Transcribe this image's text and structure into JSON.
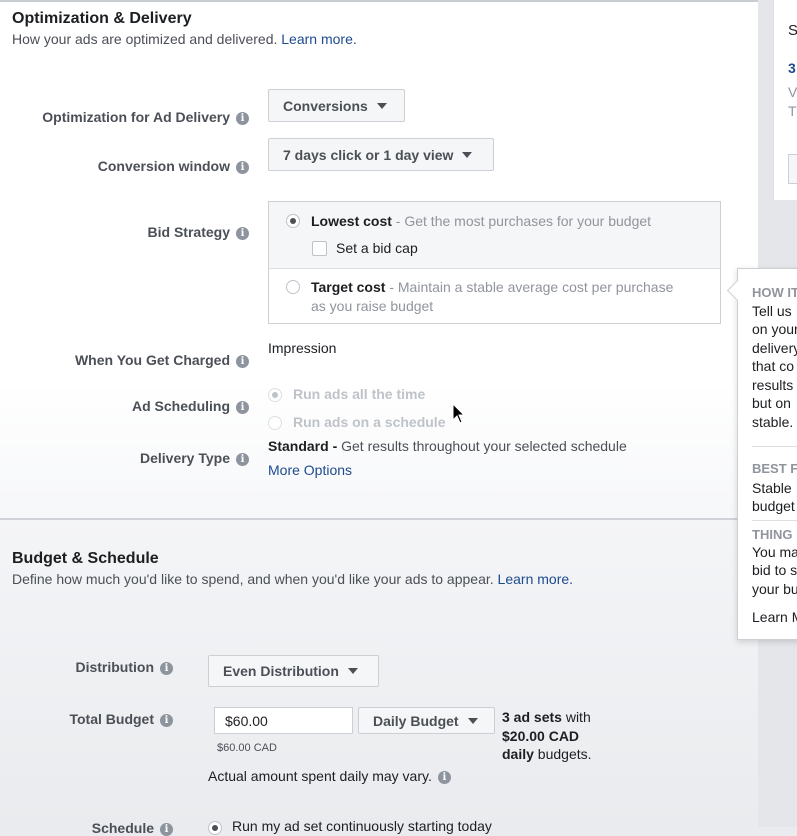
{
  "optimization": {
    "title": "Optimization & Delivery",
    "subtitle": "How your ads are optimized and delivered.",
    "learn_more": "Learn more.",
    "opt_label": "Optimization for Ad Delivery",
    "opt_value": "Conversions",
    "window_label": "Conversion window",
    "window_value": "7 days click or 1 day view",
    "bid_label": "Bid Strategy",
    "bid_lowest_title": "Lowest cost",
    "bid_lowest_desc": " - Get the most purchases for your budget",
    "bid_cap_label": "Set a bid cap",
    "bid_target_title": "Target cost",
    "bid_target_desc": " - Maintain a stable average cost per purchase",
    "bid_target_desc2": "as you raise budget",
    "charged_label": "When You Get Charged",
    "charged_value": "Impression",
    "scheduling_label": "Ad Scheduling",
    "scheduling_all": "Run ads all the time",
    "scheduling_schedule": "Run ads on a schedule",
    "delivery_label": "Delivery Type",
    "delivery_value_bold": "Standard -",
    "delivery_value_desc": " Get results throughout your selected schedule",
    "more_options": "More Options"
  },
  "budget": {
    "title": "Budget & Schedule",
    "subtitle": "Define how much you'd like to spend, and when you'd like your ads to appear.",
    "learn_more": "Learn more.",
    "distribution_label": "Distribution",
    "distribution_value": "Even Distribution",
    "total_label": "Total Budget",
    "total_value": "$60.00",
    "total_cad": "$60.00 CAD",
    "budget_type": "Daily Budget",
    "adsets_line1_bold": "3 ad sets",
    "adsets_line1_rest": " with",
    "adsets_line2_bold": "$20.00 CAD",
    "adsets_line3_bold": "daily",
    "adsets_line3_rest": " budgets.",
    "actual_note": "Actual amount spent daily may vary.",
    "schedule_label_partial": "Schedule",
    "schedule_option_partial": "Run my ad set continuously starting today"
  },
  "tooltip": {
    "h1": "HOW IT",
    "t1": [
      "Tell us",
      "on your",
      "delivery",
      "that co",
      "results",
      "but on",
      "stable."
    ],
    "h2": "BEST F",
    "t2": [
      "Stable",
      "budget"
    ],
    "h3": "THING",
    "t3": [
      "You ma",
      "bid to s",
      "your bu"
    ],
    "learn": "Learn M"
  },
  "summary": {
    "s": "S",
    "n": "3",
    "l1": "V",
    "l2": "T"
  },
  "info_glyph": "i",
  "colors": {
    "link": "#1d4a8f",
    "label": "#4b4f56",
    "disabled": "#bec3c9"
  }
}
